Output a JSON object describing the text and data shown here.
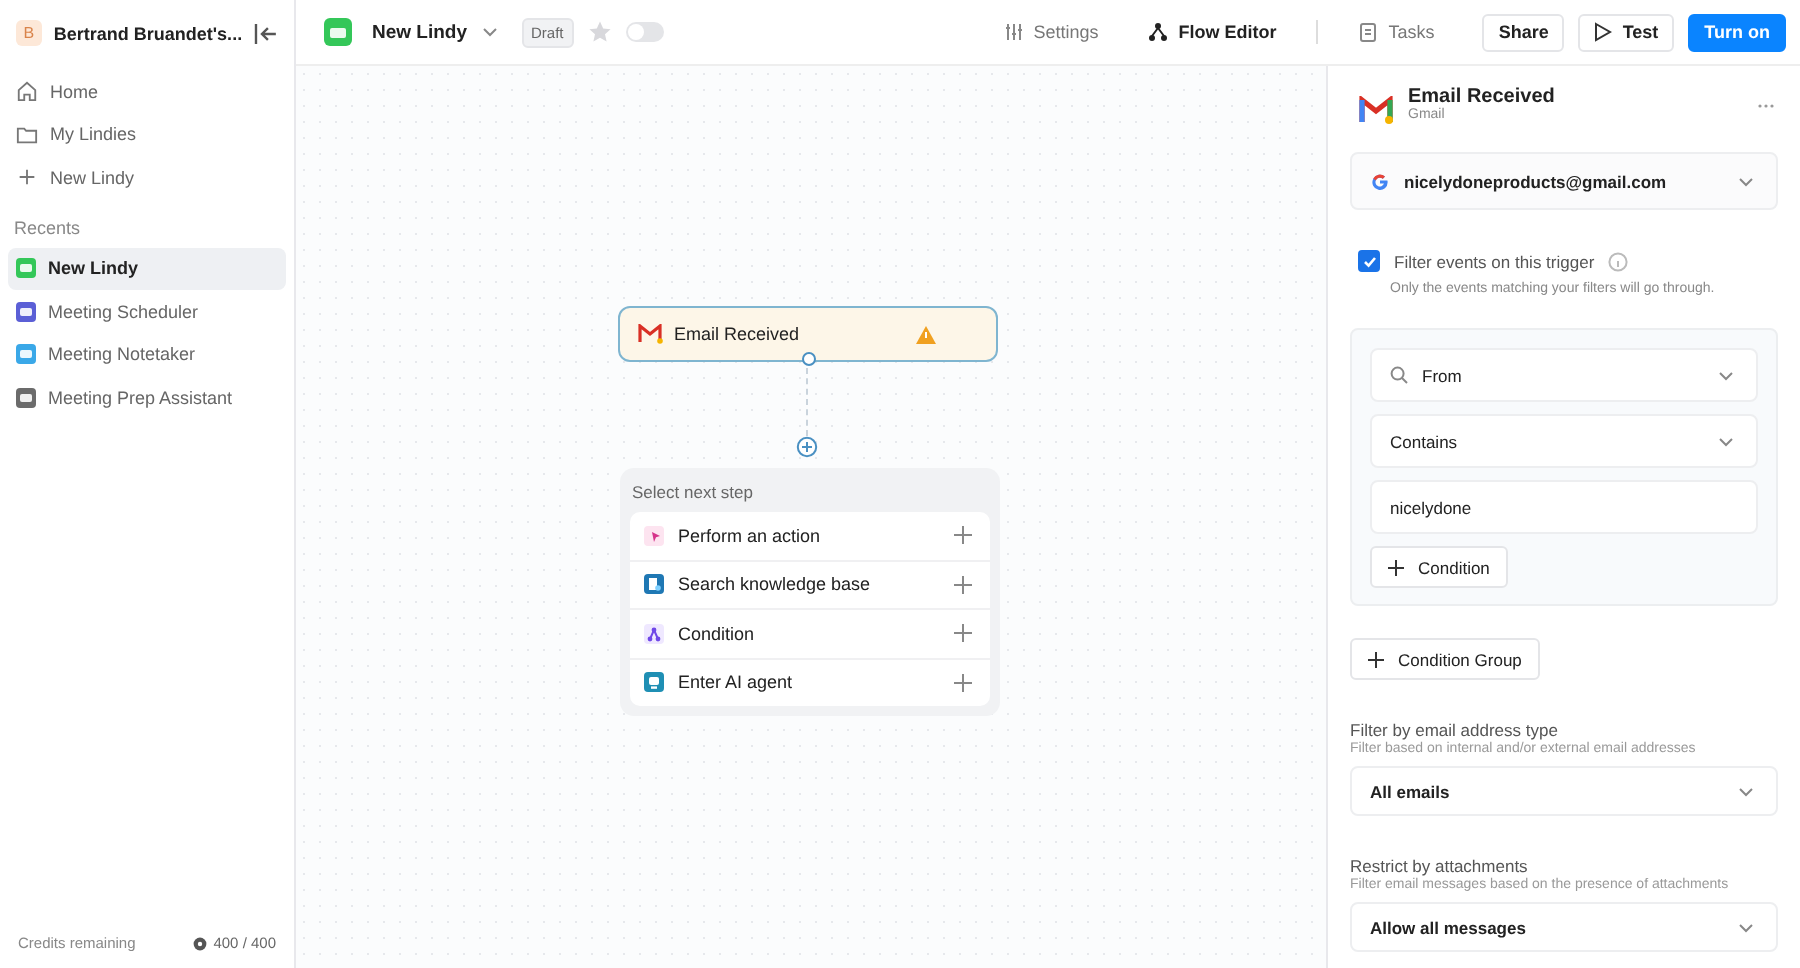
{
  "sidebar": {
    "workspace_initial": "B",
    "workspace_name": "Bertrand Bruandet's...",
    "nav": [
      {
        "kind": "home",
        "label": "Home"
      },
      {
        "kind": "folder",
        "label": "My Lindies"
      },
      {
        "kind": "plus",
        "label": "New Lindy"
      }
    ],
    "recents_label": "Recents",
    "recents": [
      {
        "label": "New Lindy",
        "color": "#34c759",
        "selected": true
      },
      {
        "label": "Meeting Scheduler",
        "color": "#5b5fd6",
        "selected": false
      },
      {
        "label": "Meeting Notetaker",
        "color": "#3aa8e8",
        "selected": false
      },
      {
        "label": "Meeting Prep Assistant",
        "color": "#6b6b6b",
        "selected": false
      }
    ],
    "credits_label": "Credits remaining",
    "credits_value": "400 / 400"
  },
  "header": {
    "title": "New Lindy",
    "status": "Draft",
    "starred": false,
    "enabled": false,
    "tabs": [
      {
        "kind": "settings",
        "label": "Settings",
        "selected": false
      },
      {
        "kind": "flow",
        "label": "Flow Editor",
        "selected": true
      },
      {
        "kind": "tasks",
        "label": "Tasks",
        "selected": false
      }
    ],
    "buttons": [
      {
        "kind": "plain",
        "label": "Share"
      },
      {
        "kind": "test",
        "label": "Test"
      },
      {
        "kind": "primary",
        "label": "Turn on"
      }
    ]
  },
  "canvas": {
    "trigger": {
      "label": "Email Received",
      "warning": true
    },
    "next_step": {
      "title": "Select next step",
      "options": [
        {
          "kind": "action",
          "label": "Perform an action"
        },
        {
          "kind": "knowledge",
          "label": "Search knowledge base"
        },
        {
          "kind": "condition",
          "label": "Condition"
        },
        {
          "kind": "agent",
          "label": "Enter AI agent"
        }
      ]
    }
  },
  "panel": {
    "title": "Email Received",
    "subtitle": "Gmail",
    "account": "nicelydoneproducts@gmail.com",
    "filter": {
      "checked": true,
      "label": "Filter events on this trigger",
      "hint": "Only the events matching your filters will go through."
    },
    "condition": {
      "field": "From",
      "operator": "Contains",
      "value": "nicelydone",
      "add_label": "Condition"
    },
    "add_group_label": "Condition Group",
    "sections": [
      {
        "title": "Filter by email address type",
        "hint": "Filter based on internal and/or external email addresses",
        "value": "All emails"
      },
      {
        "title": "Restrict by attachments",
        "hint": "Filter email messages based on the presence of attachments",
        "value": "Allow all messages"
      }
    ]
  }
}
